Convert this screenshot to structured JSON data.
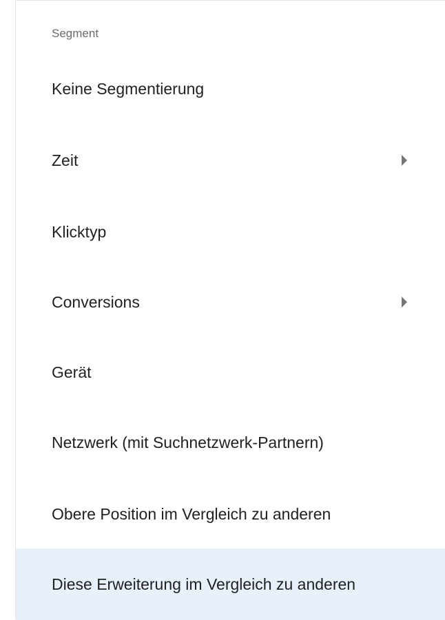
{
  "menu": {
    "header": "Segment",
    "items": [
      {
        "label": "Keine Segmentierung",
        "has_submenu": false
      },
      {
        "label": "Zeit",
        "has_submenu": true
      },
      {
        "label": "Klicktyp",
        "has_submenu": false
      },
      {
        "label": "Conversions",
        "has_submenu": true
      },
      {
        "label": "Gerät",
        "has_submenu": false
      },
      {
        "label": "Netzwerk (mit Suchnetzwerk-Partnern)",
        "has_submenu": false
      },
      {
        "label": "Obere Position im Vergleich zu anderen",
        "has_submenu": false
      },
      {
        "label": "Diese Erweiterung im Vergleich zu anderen",
        "has_submenu": false,
        "highlighted": true
      }
    ],
    "colors": {
      "highlight": "#e8f0fc",
      "text": "#202124",
      "header_text": "#6b6b6b",
      "chevron": "#757575"
    }
  }
}
